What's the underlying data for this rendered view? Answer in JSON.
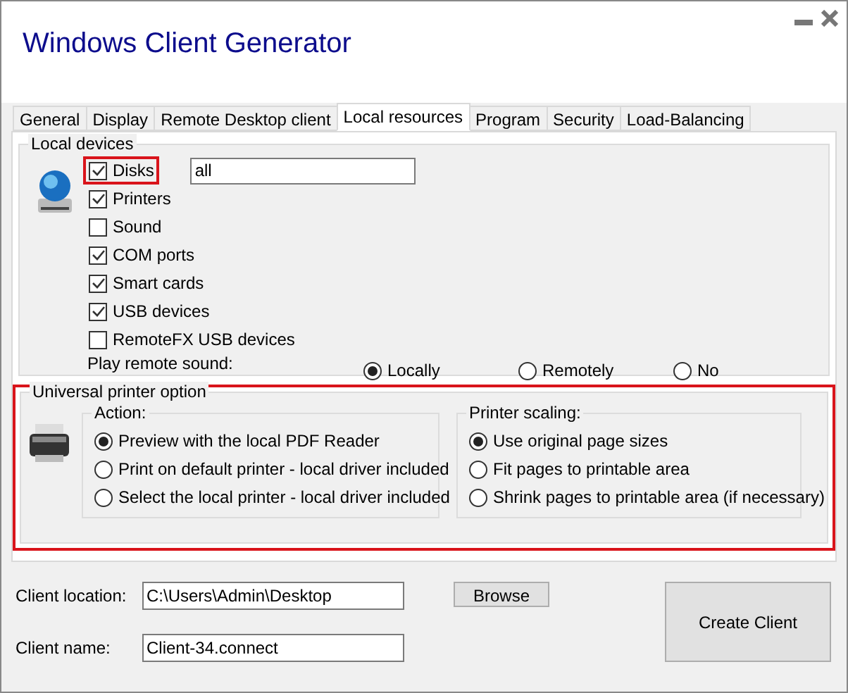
{
  "window": {
    "title": "Windows Client Generator"
  },
  "tabs": [
    {
      "label": "General",
      "selected": false
    },
    {
      "label": "Display",
      "selected": false
    },
    {
      "label": "Remote Desktop client",
      "selected": false
    },
    {
      "label": "Local resources",
      "selected": true
    },
    {
      "label": "Program",
      "selected": false
    },
    {
      "label": "Security",
      "selected": false
    },
    {
      "label": "Load-Balancing",
      "selected": false
    }
  ],
  "local_devices": {
    "title": "Local devices",
    "items": [
      {
        "label": "Disks",
        "checked": true,
        "highlighted": true,
        "value": "all"
      },
      {
        "label": "Printers",
        "checked": true,
        "highlighted": false
      },
      {
        "label": "Sound",
        "checked": false,
        "highlighted": false
      },
      {
        "label": "COM ports",
        "checked": true,
        "highlighted": false
      },
      {
        "label": "Smart cards",
        "checked": true,
        "highlighted": false
      },
      {
        "label": "USB devices",
        "checked": true,
        "highlighted": false
      },
      {
        "label": "RemoteFX USB devices",
        "checked": false,
        "highlighted": false
      }
    ],
    "sound_label": "Play remote sound:",
    "sound_options": [
      {
        "label": "Locally",
        "selected": true
      },
      {
        "label": "Remotely",
        "selected": false
      },
      {
        "label": "No",
        "selected": false
      }
    ]
  },
  "printer": {
    "title": "Universal printer option",
    "highlighted": true,
    "action": {
      "title": "Action:",
      "options": [
        {
          "label": "Preview with the local PDF Reader",
          "selected": true
        },
        {
          "label": "Print on default printer - local driver included",
          "selected": false
        },
        {
          "label": "Select the local printer - local driver included",
          "selected": false
        }
      ]
    },
    "scaling": {
      "title": "Printer scaling:",
      "options": [
        {
          "label": "Use original page sizes",
          "selected": true
        },
        {
          "label": "Fit pages to printable area",
          "selected": false
        },
        {
          "label": "Shrink pages to printable area (if necessary)",
          "selected": false
        }
      ]
    }
  },
  "bottom": {
    "location_label": "Client location:",
    "location_value": "C:\\Users\\Admin\\Desktop",
    "name_label": "Client name:",
    "name_value": "Client-34.connect",
    "browse": "Browse",
    "create": "Create Client"
  }
}
